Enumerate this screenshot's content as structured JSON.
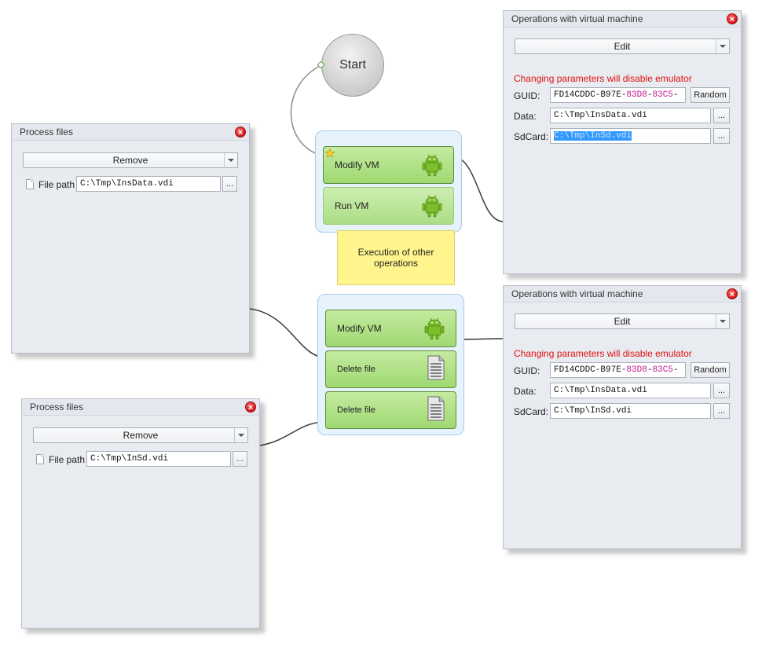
{
  "start": {
    "label": "Start"
  },
  "group1": {
    "nodes": [
      {
        "label": "Modify VM",
        "icon": "android-icon"
      },
      {
        "label": "Run VM",
        "icon": "android-icon"
      }
    ]
  },
  "note": {
    "text": "Execution of other operations"
  },
  "group2": {
    "nodes": [
      {
        "label": "Modify VM",
        "icon": "android-icon"
      },
      {
        "label": "Delete file",
        "icon": "document-icon"
      },
      {
        "label": "Delete file",
        "icon": "document-icon"
      }
    ]
  },
  "process_files_1": {
    "title": "Process files",
    "action": "Remove",
    "file_path_label": "File path",
    "file_path": "C:\\Tmp\\InsData.vdi",
    "browse": "..."
  },
  "process_files_2": {
    "title": "Process files",
    "action": "Remove",
    "file_path_label": "File path",
    "file_path": "C:\\Tmp\\InSd.vdi",
    "browse": "..."
  },
  "vm_ops_1": {
    "title": "Operations with virtual machine",
    "action": "Edit",
    "warning": "Changing parameters will disable emulator",
    "guid_label": "GUID:",
    "guid_parts": [
      "FD14CDDC-B97E-",
      "83D8",
      "-",
      "83C5",
      "-"
    ],
    "random": "Random",
    "data_label": "Data:",
    "data_value": "C:\\Tmp\\InsData.vdi",
    "sdcard_label": "SdCard:",
    "sdcard_value": "C:\\Tmp\\InSd.vdi",
    "browse": "..."
  },
  "vm_ops_2": {
    "title": "Operations with virtual machine",
    "action": "Edit",
    "warning": "Changing parameters will disable emulator",
    "guid_label": "GUID:",
    "guid_parts": [
      "FD14CDDC-B97E-",
      "83D8",
      "-",
      "83C5",
      "-"
    ],
    "random": "Random",
    "data_label": "Data:",
    "data_value": "C:\\Tmp\\InsData.vdi",
    "sdcard_label": "SdCard:",
    "sdcard_value": "C:\\Tmp\\InSd.vdi",
    "browse": "..."
  },
  "colors": {
    "guid_accent": "#c0188c",
    "warning": "#e01010",
    "node_green": "#9fd872",
    "group_blue": "#e6f2fc",
    "note_yellow": "#fff58c"
  }
}
